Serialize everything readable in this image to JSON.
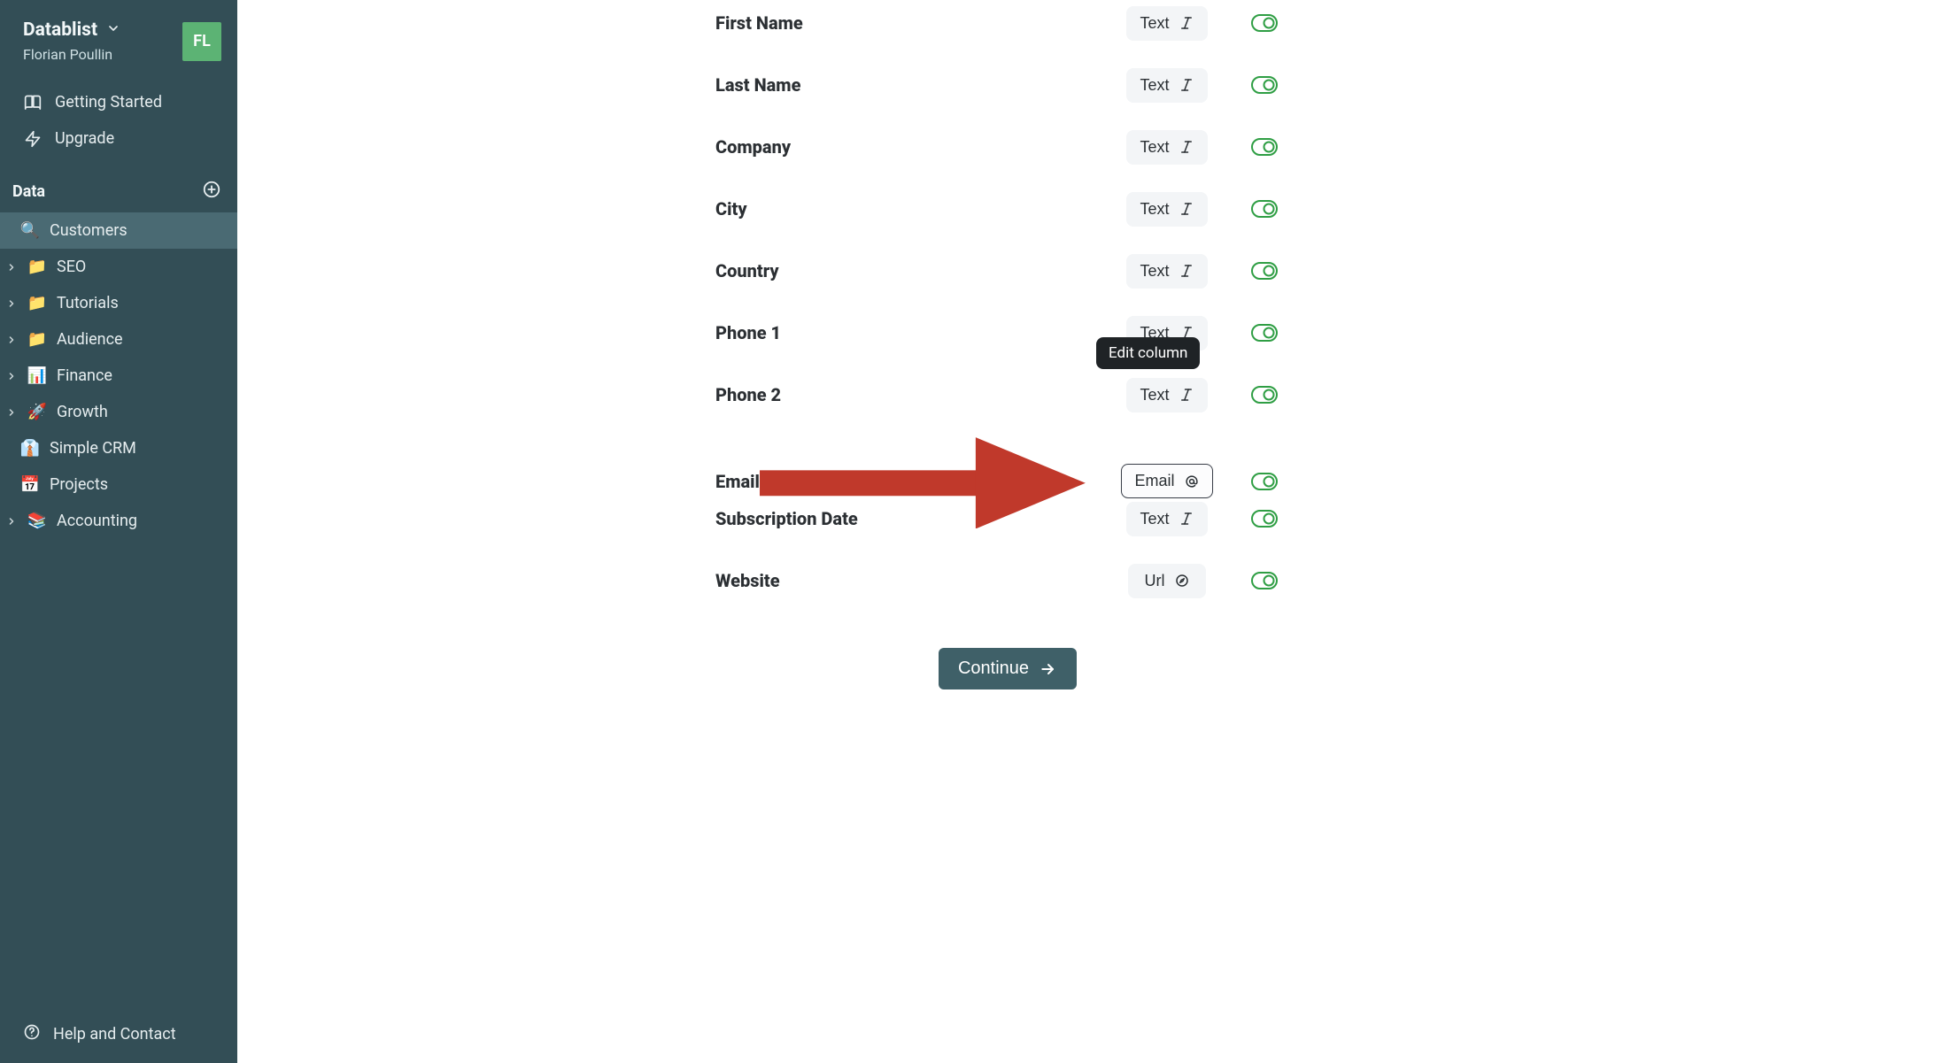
{
  "brand": {
    "name": "Datablist",
    "user": "Florian Poullin",
    "avatar": "FL"
  },
  "nav": {
    "getting_started": "Getting Started",
    "upgrade": "Upgrade"
  },
  "data_section": {
    "title": "Data",
    "items": [
      {
        "emoji": "🔍",
        "label": "Customers",
        "has_children": false,
        "active": true
      },
      {
        "emoji": "📁",
        "label": "SEO",
        "has_children": true,
        "active": false
      },
      {
        "emoji": "📁",
        "label": "Tutorials",
        "has_children": true,
        "active": false
      },
      {
        "emoji": "📁",
        "label": "Audience",
        "has_children": true,
        "active": false
      },
      {
        "emoji": "📊",
        "label": "Finance",
        "has_children": true,
        "active": false
      },
      {
        "emoji": "🚀",
        "label": "Growth",
        "has_children": true,
        "active": false
      },
      {
        "emoji": "👔",
        "label": "Simple CRM",
        "has_children": false,
        "active": false
      },
      {
        "emoji": "📅",
        "label": "Projects",
        "has_children": false,
        "active": false
      },
      {
        "emoji": "📚",
        "label": "Accounting",
        "has_children": true,
        "active": false
      }
    ]
  },
  "footer": {
    "help": "Help and Contact"
  },
  "mapping": {
    "tooltip": "Edit column",
    "rows": [
      {
        "label": "First Name",
        "type_label": "Text",
        "type_icon": "italic",
        "selected": false,
        "toggled": true
      },
      {
        "label": "Last Name",
        "type_label": "Text",
        "type_icon": "italic",
        "selected": false,
        "toggled": true
      },
      {
        "label": "Company",
        "type_label": "Text",
        "type_icon": "italic",
        "selected": false,
        "toggled": true
      },
      {
        "label": "City",
        "type_label": "Text",
        "type_icon": "italic",
        "selected": false,
        "toggled": true
      },
      {
        "label": "Country",
        "type_label": "Text",
        "type_icon": "italic",
        "selected": false,
        "toggled": true
      },
      {
        "label": "Phone 1",
        "type_label": "Text",
        "type_icon": "italic",
        "selected": false,
        "toggled": true
      },
      {
        "label": "Phone 2",
        "type_label": "Text",
        "type_icon": "italic",
        "selected": false,
        "toggled": true,
        "tooltip": true
      },
      {
        "label": "Email",
        "type_label": "Email",
        "type_icon": "at",
        "selected": true,
        "toggled": true,
        "annotated": true
      },
      {
        "label": "Subscription Date",
        "type_label": "Text",
        "type_icon": "italic",
        "selected": false,
        "toggled": true
      },
      {
        "label": "Website",
        "type_label": "Url",
        "type_icon": "compass",
        "selected": false,
        "toggled": true
      }
    ],
    "continue": "Continue"
  },
  "colors": {
    "sidebar_bg": "#334e56",
    "accent_green": "#2f9e44",
    "avatar_green": "#5cb374",
    "arrow_red": "#c0392b",
    "continue_bg": "#3f6068"
  }
}
